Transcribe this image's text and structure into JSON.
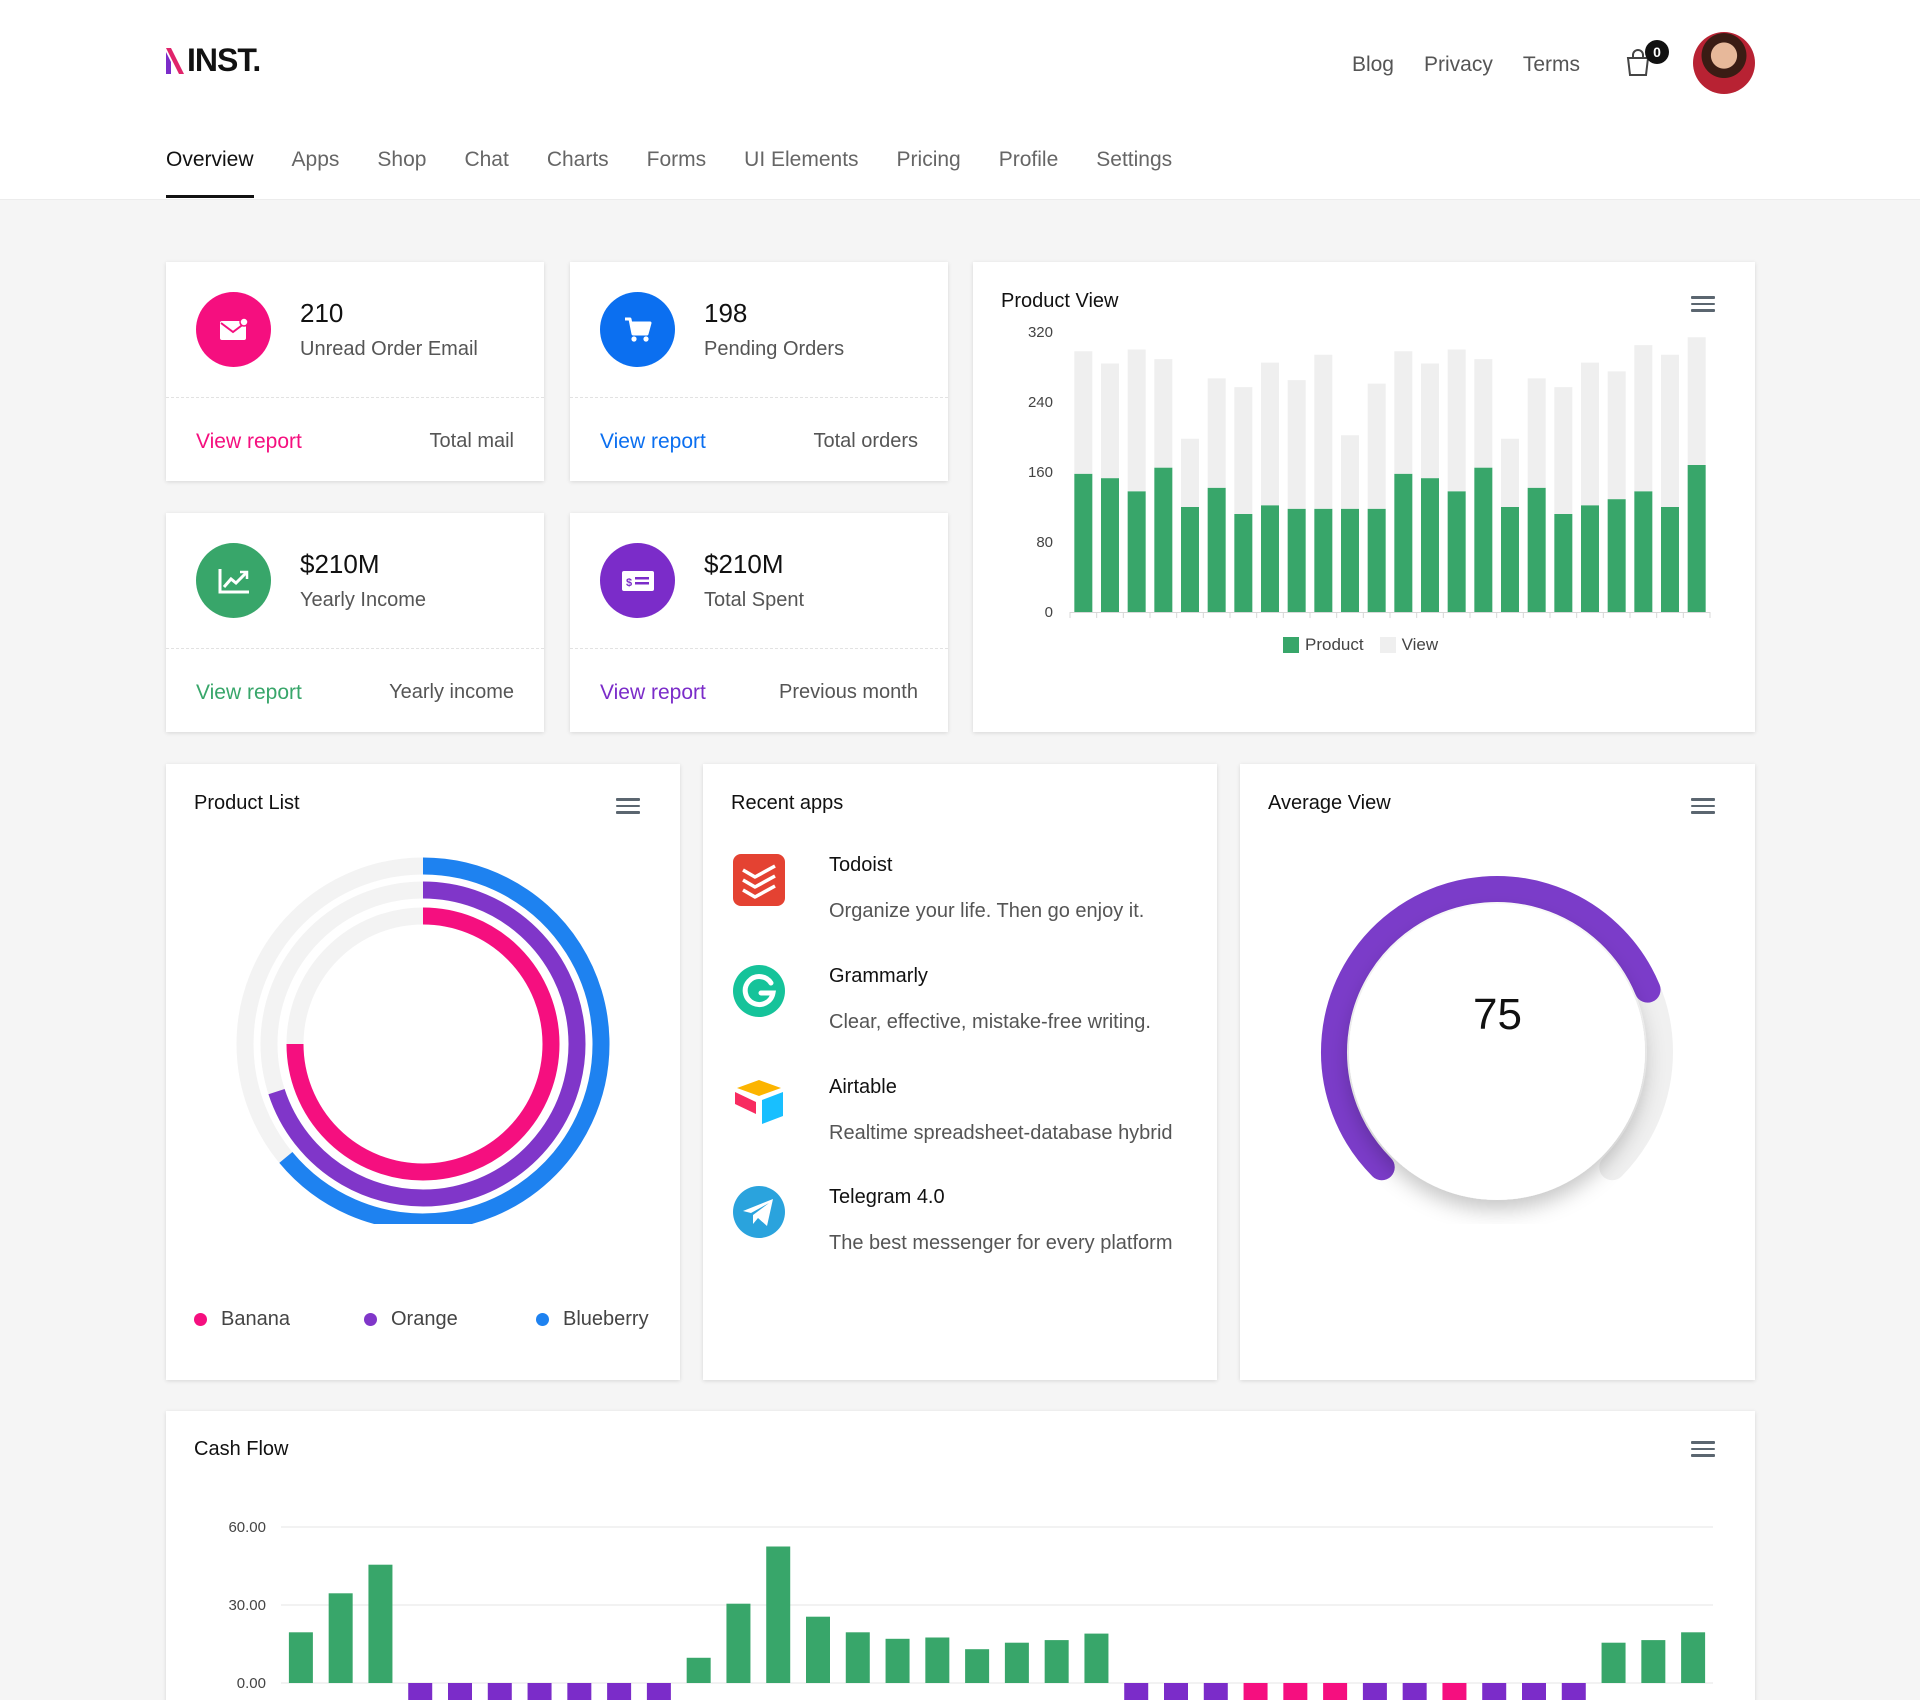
{
  "header": {
    "logo_text": "INST.",
    "links": [
      "Blog",
      "Privacy",
      "Terms"
    ],
    "cart_count": "0"
  },
  "nav": {
    "items": [
      "Overview",
      "Apps",
      "Shop",
      "Chat",
      "Charts",
      "Forms",
      "UI Elements",
      "Pricing",
      "Profile",
      "Settings"
    ],
    "active": "Overview"
  },
  "stats": [
    {
      "value": "210",
      "label": "Unread Order Email",
      "link": "View report",
      "note": "Total mail",
      "color": "#f50f7f",
      "icon": "mail-icon"
    },
    {
      "value": "198",
      "label": "Pending Orders",
      "link": "View report",
      "note": "Total orders",
      "color": "#0b6ff0",
      "icon": "cart-icon"
    },
    {
      "value": "$210M",
      "label": "Yearly Income",
      "link": "View report",
      "note": "Yearly income",
      "color": "#38a66a",
      "icon": "trend-icon"
    },
    {
      "value": "$210M",
      "label": "Total Spent",
      "link": "View report",
      "note": "Previous month",
      "color": "#7b2cc9",
      "icon": "bill-icon"
    }
  ],
  "product_view": {
    "title": "Product View",
    "colors": {
      "product": "#38a66a",
      "view": "#efefef"
    },
    "chart_data": {
      "type": "bar",
      "stacked": true,
      "ylim": [
        0,
        320
      ],
      "yticks": [
        0,
        80,
        160,
        240,
        320
      ],
      "grid": false,
      "legend": "bottom",
      "series": [
        {
          "name": "Product",
          "values": [
            158,
            153,
            138,
            165,
            120,
            142,
            112,
            122,
            118,
            118,
            118,
            118,
            158,
            153,
            138,
            165,
            120,
            142,
            112,
            122,
            129,
            138,
            120,
            168
          ]
        },
        {
          "name": "View",
          "values": [
            140,
            131,
            162,
            124,
            78,
            125,
            145,
            163,
            147,
            176,
            84,
            143,
            140,
            131,
            162,
            124,
            78,
            125,
            145,
            163,
            146,
            167,
            174,
            146
          ]
        }
      ]
    }
  },
  "product_list": {
    "title": "Product List",
    "chart_data": {
      "type": "radialBar",
      "series": [
        {
          "name": "Banana",
          "value": 75,
          "color": "#f50f7f"
        },
        {
          "name": "Orange",
          "value": 70,
          "color": "#8036c9"
        },
        {
          "name": "Blueberry",
          "value": 64,
          "color": "#1e82f0"
        }
      ]
    }
  },
  "recent_apps": {
    "title": "Recent apps",
    "items": [
      {
        "name": "Todoist",
        "desc": "Organize your life. Then go enjoy it.",
        "icon": "todoist-icon"
      },
      {
        "name": "Grammarly",
        "desc": "Clear, effective, mistake-free writing.",
        "icon": "grammarly-icon"
      },
      {
        "name": "Airtable",
        "desc": "Realtime spreadsheet-database hybrid",
        "icon": "airtable-icon"
      },
      {
        "name": "Telegram 4.0",
        "desc": "The best messenger for every platform",
        "icon": "telegram-icon"
      }
    ]
  },
  "average_view": {
    "title": "Average View",
    "value": "75",
    "chart_data": {
      "type": "radialBar",
      "value": 75,
      "color": "#7b3cc9"
    }
  },
  "cash_flow": {
    "title": "Cash Flow",
    "colors": {
      "positive": "#38a66a",
      "negative": "#7b2cc9",
      "accent": "#f50f7f"
    },
    "chart_data": {
      "type": "bar",
      "ylim": [
        0,
        60
      ],
      "yticks": [
        "0.00",
        "30.00",
        "60.00"
      ],
      "grid": true,
      "values": [
        19.5,
        34.5,
        45.5,
        -10,
        -11,
        -11,
        -11,
        -11,
        -11,
        -11,
        9.7,
        30.5,
        52.5,
        25.5,
        19.5,
        17,
        17.5,
        13,
        15.5,
        16.5,
        19,
        -11,
        -11,
        -11,
        -11,
        -11,
        -11,
        -11,
        -11,
        -11,
        -11,
        -11,
        -11,
        15.5,
        16.5,
        19.5
      ],
      "highlight_indices": [
        24,
        25,
        26,
        29
      ]
    }
  }
}
